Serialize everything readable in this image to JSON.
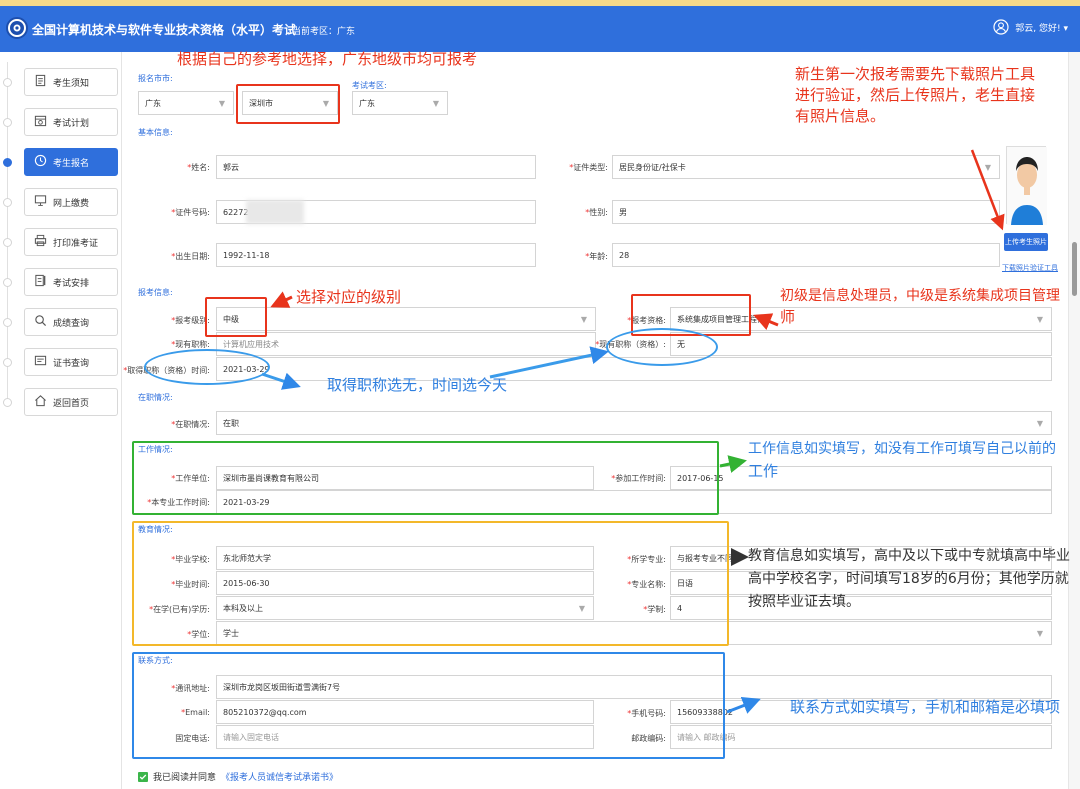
{
  "header": {
    "app_title": "全国计算机技术与软件专业技术资格（水平）考试",
    "exam_location": "当前考区：广东",
    "user_name": "郭云, 您好! ▾"
  },
  "sidebar": {
    "items": [
      {
        "label": "考生须知",
        "icon": "document-icon"
      },
      {
        "label": "考试计划",
        "icon": "calendar-icon"
      },
      {
        "label": "考生报名",
        "icon": "clock-icon",
        "active": true
      },
      {
        "label": "网上缴费",
        "icon": "monitor-icon"
      },
      {
        "label": "打印准考证",
        "icon": "printer-icon"
      },
      {
        "label": "考试安排",
        "icon": "schedule-icon"
      },
      {
        "label": "成绩查询",
        "icon": "search-icon"
      },
      {
        "label": "证书查询",
        "icon": "certificate-icon"
      },
      {
        "label": "返回首页",
        "icon": "home-icon"
      }
    ]
  },
  "form": {
    "region": {
      "city_label": "报名市市:",
      "district_label": "考试考区:",
      "province": "广东",
      "city": "深圳市",
      "district": "广东"
    },
    "basic": {
      "section_label": "基本信息:",
      "name_label": "姓名:",
      "name": "郭云",
      "id_type_label": "证件类型:",
      "id_type": "居民身份证/社保卡",
      "id_no_label": "证件号码:",
      "id_no": "62272",
      "gender_label": "性别:",
      "gender": "男",
      "birth_label": "出生日期:",
      "birth": "1992-11-18",
      "age_label": "年龄:",
      "age": "28",
      "upload_button": "上传考生照片",
      "download_link": "下载照片验证工具"
    },
    "exam": {
      "section_label": "报考信息:",
      "level_label": "报考级别:",
      "level": "中级",
      "qual_label": "报考资格:",
      "qual": "系统集成项目管理工程师",
      "title_label": "现有职称:",
      "title_value": "计算机应用技术",
      "have_title_label": "现有职称（资格）:",
      "have_title": "无",
      "obtain_label": "取得职称（资格）时间:",
      "obtain_date": "2021-03-29"
    },
    "job": {
      "section_label": "在职情况:",
      "status_label": "在职情况:",
      "status": "在职"
    },
    "work": {
      "section_label": "工作情况:",
      "company_label": "工作单位:",
      "company": "深圳市墨尚课教育有限公司",
      "start_label": "参加工作时间:",
      "start": "2017-06-15",
      "major_time_label": "本专业工作时间:",
      "major_time": "2021-03-29"
    },
    "edu": {
      "section_label": "教育情况:",
      "school_label": "毕业学校:",
      "school": "东北师范大学",
      "major_label": "所学专业:",
      "major": "与报考专业不同",
      "grad_label": "毕业时间:",
      "grad": "2015-06-30",
      "major_name_label": "专业名称:",
      "major_name": "日语",
      "degree_level_label": "在学(已有)学历:",
      "degree_level": "本科及以上",
      "years_label": "学制:",
      "years": "4",
      "degree_label": "学位:",
      "degree": "学士"
    },
    "contact": {
      "section_label": "联系方式:",
      "address_label": "通讯地址:",
      "address": "深圳市龙岗区坂田街道雪满街7号",
      "email_label": "Email:",
      "email": "805210372@qq.com",
      "phone_label": "手机号码:",
      "phone": "15609338802",
      "tel_label": "固定电话:",
      "tel_placeholder": "请输入固定电话",
      "post_label": "邮政编码:",
      "post_placeholder": "请输入 邮政编码"
    },
    "agree_text": "我已阅读并同意",
    "agree_link": "《报考人员诚信考试承诺书》"
  },
  "annotations": {
    "region_note": "根据自己的参考地选择，广东地级市均可报考",
    "photo_note_1": "新生第一次报考需要先下载照片工具",
    "photo_note_2": "进行验证，然后上传照片，老生直接",
    "photo_note_3": "有照片信息。",
    "level_note": "选择对应的级别",
    "qual_note_1": "初级是信息处理员，中级是系统集成项目管理",
    "qual_note_2": "师",
    "title_note": "取得职称选无，时间选今天",
    "work_note_1": "工作信息如实填写，如没有工作可填写自己以前的",
    "work_note_2": "工作",
    "edu_note_1": "教育信息如实填写，高中及以下或中专就填高中毕业",
    "edu_note_2": "高中学校名字，时间填写18岁的6月份；其他学历就",
    "edu_note_3": "按照毕业证去填。",
    "contact_note": "联系方式如实填写，手机和邮箱是必填项"
  },
  "colors": {
    "header_blue": "#2f6fdc",
    "annotation_red": "#e8341c",
    "annotation_blue": "#2f7fdf",
    "work_green": "#33b233",
    "edu_orange": "#f3b82a"
  }
}
